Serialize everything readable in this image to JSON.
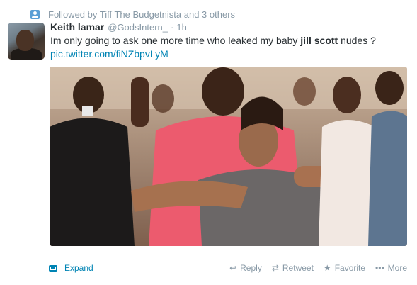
{
  "context": {
    "text": "Followed by Tiff The Budgetnista and 3 others",
    "icon": "person-icon"
  },
  "tweet": {
    "author_name": "Keith lamar",
    "author_handle": "@GodsIntern_",
    "separator": "·",
    "timestamp": "1h",
    "text_before": "Im only going to ask one more time who leaked my baby ",
    "text_bold": "jill scott",
    "text_after": " nudes ?",
    "link": "pic.twitter.com/fiNZbpvLyM"
  },
  "footer": {
    "expand_label": "Expand",
    "reply_label": "Reply",
    "retweet_label": "Retweet",
    "favorite_label": "Favorite",
    "more_label": "More"
  },
  "colors": {
    "link": "#0084b4",
    "muted": "#8899a6",
    "text": "#292f33"
  }
}
